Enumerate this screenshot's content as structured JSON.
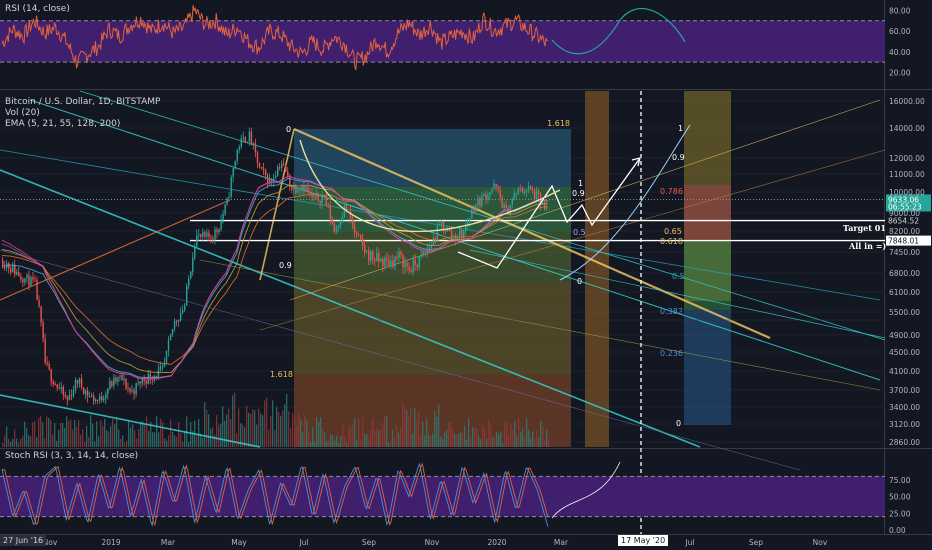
{
  "rsi": {
    "label": "RSI (14, close)",
    "ticks": [
      "80.00",
      "60.00",
      "40.00",
      "20.00"
    ],
    "tick_values": [
      80,
      60,
      40,
      20
    ],
    "bands": [
      70,
      30
    ],
    "range": [
      0,
      100
    ]
  },
  "main": {
    "legend": [
      "Bitcoin / U.S. Dollar, 1D, BITSTAMP",
      "Vol (20)",
      "EMA (5, 21, 55, 128, 200)"
    ],
    "price_ticks": [
      "16000.00",
      "14000.00",
      "12000.00",
      "11000.00",
      "10000.00",
      "9000.00",
      "8200.00",
      "7450.00",
      "6800.00",
      "6100.00",
      "5500.00",
      "4900.00",
      "4500.00",
      "4100.00",
      "3700.00",
      "3400.00",
      "3120.00",
      "2860.00"
    ],
    "tags": [
      {
        "text": "9633.06",
        "color": "#26a69a",
        "value": 9633.06
      },
      {
        "text": "06:55:23",
        "color": "#26a69a",
        "value": 9300
      },
      {
        "text": "8654.52",
        "color": "#131722",
        "value": 8654.52
      },
      {
        "text": "7848.01",
        "color": "#ffffff",
        "value": 7848.01
      }
    ],
    "level_labels": {
      "target": "Target 01",
      "all_in": "All in =)"
    },
    "fib_labels": {
      "left_1618": "1.618",
      "left_0": "0",
      "left_09": "0.9",
      "left_0618": "0.618",
      "left_1618b": "1.618",
      "mid_1": "1",
      "mid_09": "0.9",
      "mid_05": "0.5",
      "mid_0": "0",
      "right_1": "1",
      "right_09": "0.9",
      "right_0786": "0.786",
      "right_065": "0.65",
      "right_0618": "0.618",
      "right_05": "0.5",
      "right_0382": "0.382",
      "right_0236": "0.236",
      "right_0": "0",
      "right_0382b": "0.382",
      "right_0236b": "0.236",
      "right_0b": "0"
    }
  },
  "stoch": {
    "label": "Stoch RSI (3, 3, 14, 14, close)",
    "ticks": [
      "75.00",
      "50.00",
      "25.00",
      "0.00"
    ],
    "tick_values": [
      75,
      50,
      25,
      0
    ],
    "bands": [
      80,
      20
    ],
    "range": [
      0,
      100
    ]
  },
  "x_axis": {
    "labels": [
      "Nov",
      "2019",
      "Mar",
      "May",
      "Jul",
      "Sep",
      "Nov",
      "2020",
      "Mar",
      "Jul",
      "Sep",
      "Nov"
    ],
    "start_label": "27 Jun '16",
    "cursor_label": "17 May '20"
  },
  "colors": {
    "background": "#131722",
    "rsi_line": "#e0633d",
    "rsi_band": "#3f1f6e",
    "stoch_k": "#4a90d9",
    "stoch_d": "#e0633d",
    "up": "#26a69a",
    "down": "#ef5350",
    "fib_gold": "#c8a040",
    "cyan": "#35d0d0",
    "white_level": "#ffffff"
  },
  "chart_data": [
    {
      "type": "line",
      "title": "RSI (14, close)",
      "ylim": [
        0,
        100
      ],
      "y_ticks": [
        80,
        60,
        40,
        20
      ],
      "series": [
        {
          "name": "RSI (14, close)",
          "values": [
            48,
            62,
            55,
            70,
            58,
            64,
            50,
            30,
            38,
            45,
            62,
            55,
            66,
            72,
            60,
            68,
            58,
            63,
            80,
            66,
            70,
            56,
            64,
            50,
            44,
            60,
            57,
            45,
            38,
            50,
            42,
            55,
            48,
            30,
            36,
            52,
            40,
            58,
            68,
            56,
            66,
            48,
            55,
            60,
            52,
            72,
            60,
            65,
            70,
            62,
            55,
            46
          ]
        }
      ]
    },
    {
      "type": "line",
      "title": "Bitcoin / U.S. Dollar, 1D, BITSTAMP",
      "ylim": [
        2800,
        16500
      ],
      "y_ticks": [
        16000,
        14000,
        12000,
        11000,
        10000,
        9000,
        8200,
        7450,
        6800,
        6100,
        5500,
        4900,
        4500,
        4100,
        3700,
        3400,
        3120,
        2860
      ],
      "series": [
        {
          "name": "BTCUSD close",
          "values": [
            7200,
            6900,
            6600,
            6400,
            4200,
            3800,
            3500,
            3900,
            3600,
            3500,
            3800,
            3950,
            3650,
            3900,
            4000,
            4100,
            5200,
            5700,
            8000,
            7900,
            8200,
            9500,
            12800,
            13500,
            11300,
            10500,
            11800,
            10200,
            10400,
            9600,
            9800,
            8200,
            9300,
            8000,
            7400,
            7200,
            7100,
            7300,
            6900,
            7200,
            7700,
            8500,
            8000,
            8100,
            9300,
            9800,
            10300,
            9000,
            10000,
            10200,
            9700,
            8800
          ]
        }
      ],
      "annotations": [
        "Target 01",
        "All in =)"
      ]
    },
    {
      "type": "line",
      "title": "Stoch RSI (3, 3, 14, 14, close)",
      "ylim": [
        0,
        100
      ],
      "y_ticks": [
        75,
        50,
        25,
        0
      ],
      "series": [
        {
          "name": "Stoch RSI (3, 3, 14, 14, close)",
          "values": [
            90,
            20,
            60,
            5,
            80,
            95,
            15,
            70,
            10,
            85,
            30,
            95,
            20,
            75,
            5,
            90,
            40,
            98,
            10,
            80,
            25,
            95,
            15,
            60,
            90,
            8,
            70,
            35,
            98,
            20,
            85,
            10,
            65,
            95,
            30,
            80,
            5,
            90,
            50,
            100,
            15,
            75,
            20,
            95,
            40,
            85,
            10,
            90,
            30,
            95,
            60,
            5
          ]
        }
      ]
    }
  ]
}
